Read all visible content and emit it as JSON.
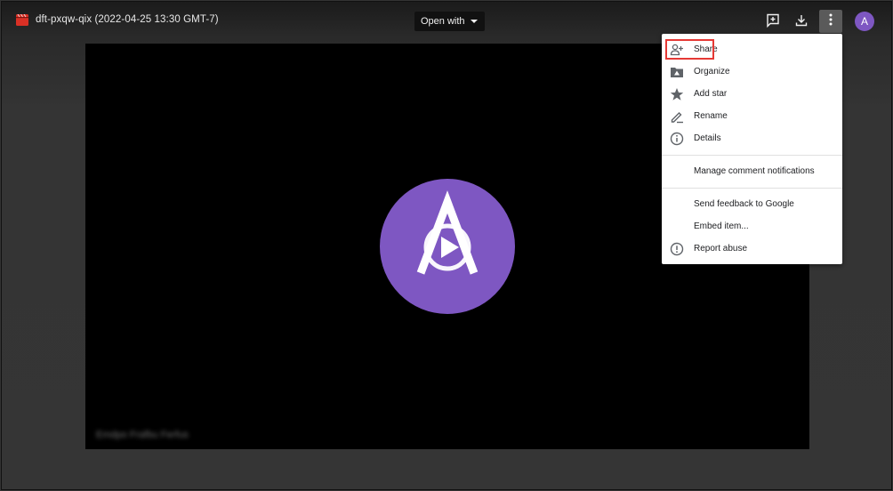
{
  "header": {
    "file_title": "dft-pxqw-qix (2022-04-25 13:30 GMT-7)",
    "open_with_label": "Open with",
    "avatar_letter": "A"
  },
  "video": {
    "caption_blurred": "Emdpo Frafbu Ferfus"
  },
  "menu": {
    "items": [
      {
        "label": "Share",
        "icon": "add-person-icon"
      },
      {
        "label": "Organize",
        "icon": "folder-move-icon"
      },
      {
        "label": "Add star",
        "icon": "star-icon"
      },
      {
        "label": "Rename",
        "icon": "pencil-icon"
      },
      {
        "label": "Details",
        "icon": "info-icon"
      },
      {
        "label": "Manage comment notifications",
        "icon": ""
      },
      {
        "label": "Send feedback to Google",
        "icon": ""
      },
      {
        "label": "Embed item...",
        "icon": ""
      },
      {
        "label": "Report abuse",
        "icon": "alert-icon"
      }
    ]
  },
  "colors": {
    "avatar": "#7e57c2",
    "highlight": "#e53935",
    "file_icon": "#d93025"
  }
}
